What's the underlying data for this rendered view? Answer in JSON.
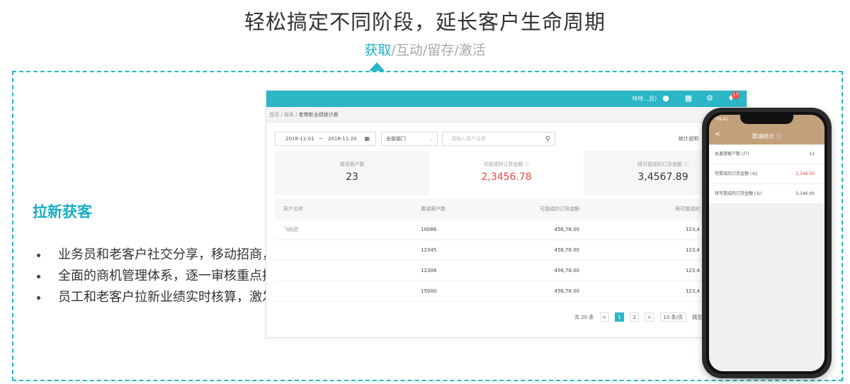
{
  "header": {
    "title": "轻松搞定不同阶段，延长客户生命周期",
    "tabs": [
      {
        "label": "获取",
        "active": true
      },
      {
        "label": "互动",
        "active": false
      },
      {
        "label": "留存",
        "active": false
      },
      {
        "label": "激活",
        "active": false
      }
    ],
    "separator": "/"
  },
  "section": {
    "title": "拉新获客",
    "bullets": [
      "业务员和老客户社交分享，移动招商，轻松获客",
      "全面的商机管理体系，逐一审核重点推进",
      "员工和老客户拉新业绩实时核算，激发拓客积极性"
    ]
  },
  "dashboard": {
    "user": "咩咩...员）",
    "badge": "17",
    "breadcrumb": [
      "首页",
      "报表",
      "老带新业绩统计表"
    ],
    "filters": {
      "date_from": "2018-11-01",
      "date_sep": "~",
      "date_to": "2018-11-20",
      "dept": "全部部门",
      "search_placeholder": "请输入客户名称",
      "help": "统计说明"
    },
    "stats": [
      {
        "label": "邀请客户数",
        "value": "23"
      },
      {
        "label": "可提成的订货金额 ⓘ",
        "value": "2,3456.78"
      },
      {
        "label": "将可提成的订货金额 ⓘ",
        "value": "3,4567.89"
      }
    ],
    "table": {
      "headers": [
        "客户名称",
        "邀请客户数",
        "可提成的订货金额",
        "将可提成的"
      ],
      "rows": [
        [
          "飞跃团",
          "10086",
          "456,78.00",
          "123,4"
        ],
        [
          "",
          "12345",
          "456,78.00",
          "123,4"
        ],
        [
          "",
          "12306",
          "456,78.00",
          "123,4"
        ],
        [
          "",
          "15000",
          "456,78.00",
          "123,4"
        ]
      ]
    },
    "pager": {
      "total": "共 20 条",
      "prev": "<",
      "pages": [
        "1",
        "2"
      ],
      "next": ">",
      "size": "10 条/页",
      "goto": "跳至"
    }
  },
  "phone": {
    "status": "09:41",
    "title": "邀请统计 ⓘ",
    "back": "<",
    "rows": [
      {
        "label": "总邀请客户数 (户)",
        "value": "13",
        "red": false
      },
      {
        "label": "可提成的订货金额 (元)",
        "value": "1,346.50",
        "red": true
      },
      {
        "label": "将可提成的订货金额 (元)",
        "value": "3,346.00",
        "red": false
      }
    ]
  }
}
